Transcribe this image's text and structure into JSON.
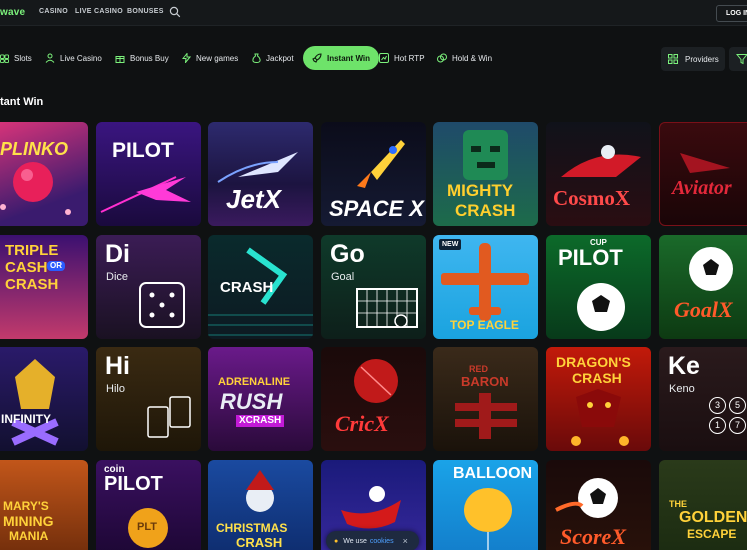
{
  "header": {
    "brand_part": "wave",
    "nav": [
      "CASINO",
      "LIVE CASINO",
      "BONUSES"
    ],
    "login_label": "LOG IN"
  },
  "categories": [
    {
      "label": "Slots",
      "icon": "slot-machine-icon"
    },
    {
      "label": "Live Casino",
      "icon": "dealer-icon"
    },
    {
      "label": "Bonus Buy",
      "icon": "gift-icon"
    },
    {
      "label": "New games",
      "icon": "lightning-icon"
    },
    {
      "label": "Jackpot",
      "icon": "moneybag-icon"
    },
    {
      "label": "Instant Win",
      "icon": "rocket-icon",
      "active": true
    },
    {
      "label": "Hot RTP",
      "icon": "chart-icon"
    },
    {
      "label": "Hold & Win",
      "icon": "coins-icon"
    }
  ],
  "providers_label": "Providers",
  "section_title": "tant Win",
  "games": [
    {
      "title": "PLINKO"
    },
    {
      "title": "PILOT"
    },
    {
      "title": "JetX"
    },
    {
      "title": "SPACE XY"
    },
    {
      "title": "MIGHTY CRASH"
    },
    {
      "title": "CosmoX"
    },
    {
      "title": "Aviator"
    },
    {
      "title": "TRIPLE CASH OR CRASH"
    },
    {
      "title": "Di",
      "sub": "Dice"
    },
    {
      "title": "CRASH X"
    },
    {
      "title": "Go",
      "sub": "Goal"
    },
    {
      "title": "TOP EAGLE",
      "badge": "NEW"
    },
    {
      "title": "PILOT",
      "sub": "CUP"
    },
    {
      "title": "GoalX"
    },
    {
      "title": "INFINITY X"
    },
    {
      "title": "Hi",
      "sub": "Hilo"
    },
    {
      "title": "ADRENALINE RUSH XCRASH"
    },
    {
      "title": "CricX"
    },
    {
      "title": "RED BARON"
    },
    {
      "title": "DRAGON'S CRASH"
    },
    {
      "title": "Ke",
      "sub": "Keno"
    },
    {
      "title": "MARY'S MINING MANIA"
    },
    {
      "title": "PILOT",
      "sub": "coin"
    },
    {
      "title": "CHRISTMAS CRASH"
    },
    {
      "title": "SANTA"
    },
    {
      "title": "BALLOON"
    },
    {
      "title": "ScoreX"
    },
    {
      "title": "THE GOLDEN ESCAPE"
    }
  ],
  "tile_labels": {
    "plinko": "PLINKO",
    "pilot": "PILOT",
    "jetx": "JetX",
    "spacexy": "SPACE XY",
    "mighty": "MIGHTY",
    "crash": "CRASH",
    "cosmox": "CosmoX",
    "aviator": "Aviator",
    "triple": "TRIPLE",
    "cash": "CASH",
    "crash2": "CRASH",
    "or": "OR",
    "di": "Di",
    "dice": "Dice",
    "crashx": "CRASH",
    "go": "Go",
    "goal": "Goal",
    "new": "NEW",
    "topeagle": "TOP EAGLE",
    "cup": "CUP",
    "pilot2": "PILOT",
    "goalx": "GoalX",
    "infinity": "INFINITY",
    "hi": "Hi",
    "hilo": "Hilo",
    "adrenaline": "ADRENALINE",
    "rush": "RUSH",
    "xcrash": "XCRASH",
    "cricx": "CricX",
    "red": "RED",
    "baron": "BARON",
    "dragons": "DRAGON'S",
    "crash3": "CRASH",
    "ke": "Ke",
    "keno": "Keno",
    "marys": "MARY'S",
    "mining": "MINING",
    "mania": "MANIA",
    "coin": "coin",
    "pilot3": "PILOT",
    "plt": "PLT",
    "christmas": "CHRISTMAS",
    "crash4": "CRASH",
    "balloon": "BALLOON",
    "scorex": "ScoreX",
    "the": "THE",
    "golden": "GOLDEN",
    "escape": "ESCAPE",
    "keno_n1": "3",
    "keno_n2": "5",
    "keno_n3": "1",
    "keno_n4": "7"
  },
  "cookie": {
    "text": "We use",
    "link": "cookies",
    "close": "×"
  },
  "colors": {
    "accent_green": "#6ee36a",
    "bg": "#0f1112"
  }
}
